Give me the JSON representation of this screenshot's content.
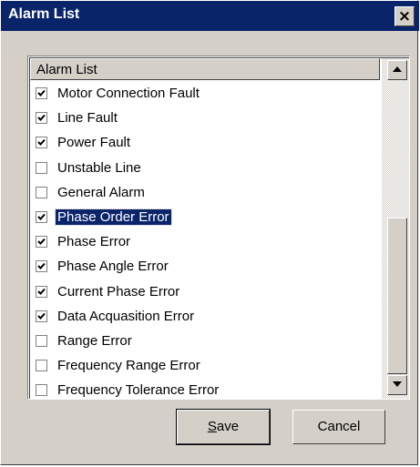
{
  "window": {
    "title": "Alarm List",
    "close_glyph": "×"
  },
  "list": {
    "header": "Alarm List",
    "items": [
      {
        "label": "Motor Connection Fault",
        "checked": true,
        "selected": false
      },
      {
        "label": "Line Fault",
        "checked": true,
        "selected": false
      },
      {
        "label": "Power Fault",
        "checked": true,
        "selected": false
      },
      {
        "label": "Unstable Line",
        "checked": false,
        "selected": false
      },
      {
        "label": "General Alarm",
        "checked": false,
        "selected": false
      },
      {
        "label": "Phase Order Error",
        "checked": true,
        "selected": true
      },
      {
        "label": "Phase Error",
        "checked": true,
        "selected": false
      },
      {
        "label": "Phase Angle Error",
        "checked": true,
        "selected": false
      },
      {
        "label": "Current Phase Error",
        "checked": true,
        "selected": false
      },
      {
        "label": "Data Acquasition Error",
        "checked": true,
        "selected": false
      },
      {
        "label": "Range Error",
        "checked": false,
        "selected": false
      },
      {
        "label": "Frequency Range Error",
        "checked": false,
        "selected": false
      },
      {
        "label": "Frequency Tolerance Error",
        "checked": false,
        "selected": false
      }
    ]
  },
  "buttons": {
    "save": {
      "mnemonic": "S",
      "rest": "ave"
    },
    "cancel": "Cancel"
  },
  "icons": {
    "close": "close-icon",
    "scroll_up": "arrow-up-icon",
    "scroll_down": "arrow-down-icon",
    "checkmark": "checkmark-icon"
  }
}
